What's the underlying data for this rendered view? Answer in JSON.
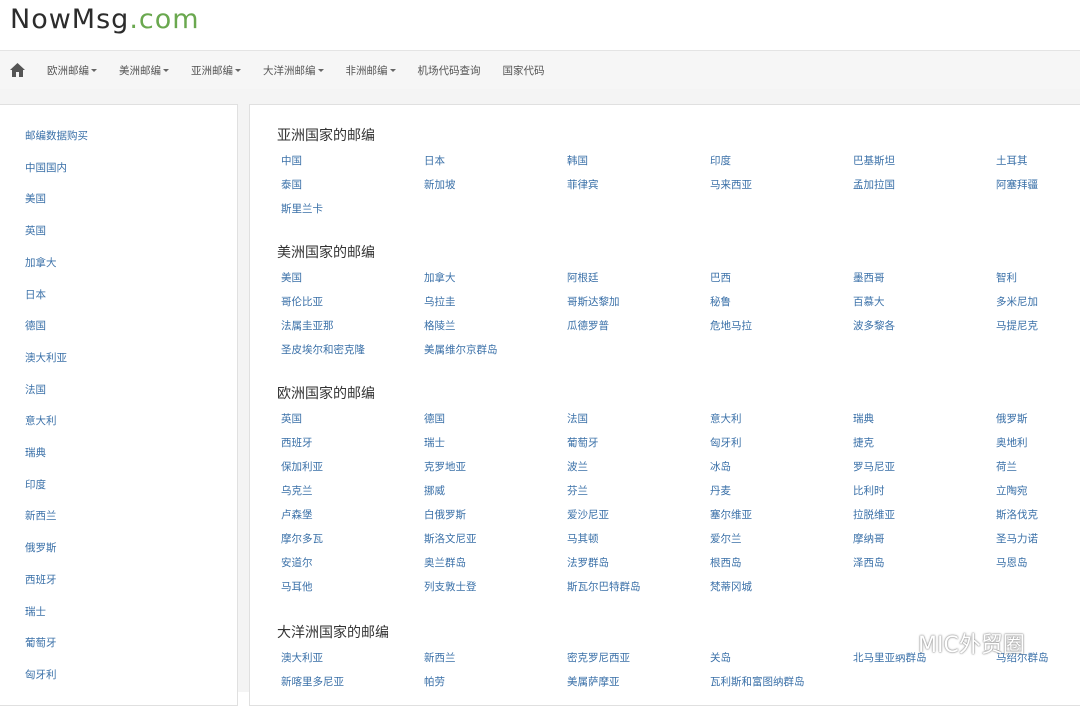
{
  "logo": {
    "main": "NowMsg",
    "suffix": ".com"
  },
  "nav": {
    "items": [
      {
        "label": "欧洲邮编",
        "dropdown": true
      },
      {
        "label": "美洲邮编",
        "dropdown": true
      },
      {
        "label": "亚洲邮编",
        "dropdown": true
      },
      {
        "label": "大洋洲邮编",
        "dropdown": true
      },
      {
        "label": "非洲邮编",
        "dropdown": true
      },
      {
        "label": "机场代码查询",
        "dropdown": false
      },
      {
        "label": "国家代码",
        "dropdown": false
      }
    ]
  },
  "sidebar": {
    "items": [
      "邮编数据购买",
      "中国国内",
      "美国",
      "英国",
      "加拿大",
      "日本",
      "德国",
      "澳大利亚",
      "法国",
      "意大利",
      "瑞典",
      "印度",
      "新西兰",
      "俄罗斯",
      "西班牙",
      "瑞士",
      "葡萄牙",
      "匈牙利"
    ]
  },
  "sections": [
    {
      "title": "亚洲国家的邮编",
      "links": [
        "中国",
        "日本",
        "韩国",
        "印度",
        "巴基斯坦",
        "土耳其",
        "泰国",
        "新加坡",
        "菲律宾",
        "马来西亚",
        "孟加拉国",
        "阿塞拜疆",
        "斯里兰卡"
      ]
    },
    {
      "title": "美洲国家的邮编",
      "links": [
        "美国",
        "加拿大",
        "阿根廷",
        "巴西",
        "墨西哥",
        "智利",
        "哥伦比亚",
        "乌拉圭",
        "哥斯达黎加",
        "秘鲁",
        "百慕大",
        "多米尼加",
        "法属圭亚那",
        "格陵兰",
        "瓜德罗普",
        "危地马拉",
        "波多黎各",
        "马提尼克",
        "圣皮埃尔和密克隆",
        "美属维尔京群岛"
      ]
    },
    {
      "title": "欧洲国家的邮编",
      "links": [
        "英国",
        "德国",
        "法国",
        "意大利",
        "瑞典",
        "俄罗斯",
        "西班牙",
        "瑞士",
        "葡萄牙",
        "匈牙利",
        "捷克",
        "奥地利",
        "保加利亚",
        "克罗地亚",
        "波兰",
        "冰岛",
        "罗马尼亚",
        "荷兰",
        "乌克兰",
        "挪威",
        "芬兰",
        "丹麦",
        "比利时",
        "立陶宛",
        "卢森堡",
        "白俄罗斯",
        "爱沙尼亚",
        "塞尔维亚",
        "拉脱维亚",
        "斯洛伐克",
        "摩尔多瓦",
        "斯洛文尼亚",
        "马其顿",
        "爱尔兰",
        "摩纳哥",
        "圣马力诺",
        "安道尔",
        "奥兰群岛",
        "法罗群岛",
        "根西岛",
        "泽西岛",
        "马恩岛",
        "马耳他",
        "列支敦士登",
        "斯瓦尔巴特群岛",
        "梵蒂冈城"
      ]
    },
    {
      "title": "大洋洲国家的邮编",
      "links": [
        "澳大利亚",
        "新西兰",
        "密克罗尼西亚",
        "关岛",
        "北马里亚纳群岛",
        "马绍尔群岛",
        "新喀里多尼亚",
        "帕劳",
        "美属萨摩亚",
        "瓦利斯和富图纳群岛"
      ]
    }
  ],
  "watermark": {
    "text": "MIC外贸圈"
  }
}
